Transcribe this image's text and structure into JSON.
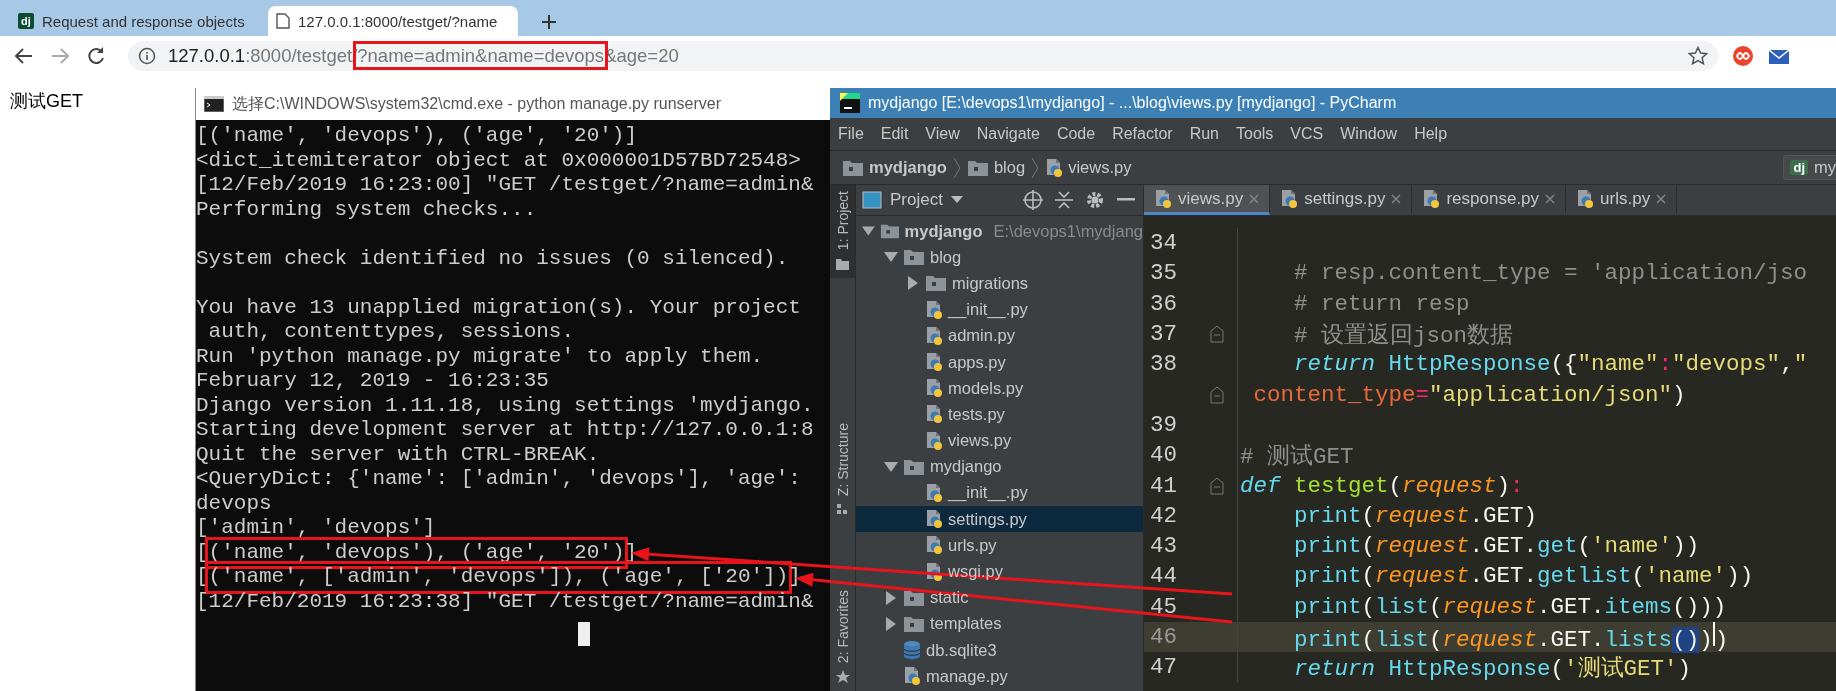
{
  "browser": {
    "tabs": [
      {
        "favicon": "dj",
        "title": "Request and response objects",
        "selected": false
      },
      {
        "title": "127.0.0.1:8000/testget/?name",
        "selected": true
      }
    ],
    "address": {
      "host": "127.0.0.1",
      "path": ":8000/testget/",
      "marked": "?name=admin&name=devops",
      "after": "&age=20"
    }
  },
  "page": {
    "heading": "测试GET"
  },
  "terminal": {
    "title": "选择C:\\WINDOWS\\system32\\cmd.exe - python  manage.py runserver",
    "lines": [
      {
        "kind": "text",
        "text": "[('name', 'devops'), ('age', '20')]"
      },
      {
        "kind": "text",
        "text": "<dict_itemiterator object at 0x000001D57BD72548>"
      },
      {
        "kind": "text",
        "text": "[12/Feb/2019 16:23:00] \"GET /testget/?name=admin&"
      },
      {
        "kind": "text",
        "text": "Performing system checks..."
      },
      {
        "kind": "blank"
      },
      {
        "kind": "text",
        "text": "System check identified no issues (0 silenced)."
      },
      {
        "kind": "blank"
      },
      {
        "kind": "text",
        "text": "You have 13 unapplied migration(s). Your project"
      },
      {
        "kind": "text",
        "text": " auth, contenttypes, sessions."
      },
      {
        "kind": "text",
        "text": "Run 'python manage.py migrate' to apply them."
      },
      {
        "kind": "text",
        "text": "February 12, 2019 - 16:23:35"
      },
      {
        "kind": "text",
        "text": "Django version 1.11.18, using settings 'mydjango."
      },
      {
        "kind": "text",
        "text": "Starting development server at http://127.0.0.1:8"
      },
      {
        "kind": "text",
        "text": "Quit the server with CTRL-BREAK."
      },
      {
        "kind": "text",
        "text": "<QueryDict: {'name': ['admin', 'devops'], 'age':"
      },
      {
        "kind": "text",
        "text": "devops"
      },
      {
        "kind": "text",
        "text": "['admin', 'devops']"
      },
      {
        "kind": "marked",
        "before": "[",
        "text": "('name', 'devops'), ('age', '20')",
        "after": "]"
      },
      {
        "kind": "marked",
        "before": "[",
        "text": "('name', ['admin', 'devops']), ('age', ['20'])",
        "after": "]"
      },
      {
        "kind": "text",
        "text": "[12/Feb/2019 16:23:38] \"GET /testget/?name=admin&"
      }
    ]
  },
  "ide": {
    "title": "mydjango [E:\\devops1\\mydjango] - ...\\blog\\views.py [mydjango] - PyCharm",
    "menu": [
      "File",
      "Edit",
      "View",
      "Navigate",
      "Code",
      "Refactor",
      "Run",
      "Tools",
      "VCS",
      "Window",
      "Help"
    ],
    "breadcrumbs": [
      {
        "kind": "folder",
        "label": "mydjango"
      },
      {
        "kind": "folder",
        "label": "blog"
      },
      {
        "kind": "python",
        "label": "views.py"
      }
    ],
    "run_config": {
      "icon": "dj",
      "label": "my"
    },
    "side_tabs": [
      {
        "label": "1: Project",
        "selected": true
      },
      {
        "label": "Z: Structure",
        "selected": false
      },
      {
        "label": "2: Favorites",
        "selected": false
      }
    ],
    "project_panel": {
      "title": "Project",
      "tree": [
        {
          "kind": "folder",
          "label": "mydjango",
          "path": "E:\\devops1\\mydjang",
          "expanded": true,
          "selected": false,
          "children": [
            {
              "kind": "folder",
              "label": "blog",
              "expanded": true,
              "selected": false,
              "children": [
                {
                  "kind": "folder",
                  "label": "migrations",
                  "expanded": false,
                  "selected": false
                },
                {
                  "kind": "python",
                  "label": "__init__.py",
                  "selected": false
                },
                {
                  "kind": "python",
                  "label": "admin.py",
                  "selected": false
                },
                {
                  "kind": "python",
                  "label": "apps.py",
                  "selected": false
                },
                {
                  "kind": "python",
                  "label": "models.py",
                  "selected": false
                },
                {
                  "kind": "python",
                  "label": "tests.py",
                  "selected": false
                },
                {
                  "kind": "python",
                  "label": "views.py",
                  "selected": false
                }
              ]
            },
            {
              "kind": "folder",
              "label": "mydjango",
              "expanded": true,
              "selected": false,
              "children": [
                {
                  "kind": "python",
                  "label": "__init__.py",
                  "selected": false
                },
                {
                  "kind": "python",
                  "label": "settings.py",
                  "selected": true
                },
                {
                  "kind": "python",
                  "label": "urls.py",
                  "selected": false
                },
                {
                  "kind": "python",
                  "label": "wsgi.py",
                  "selected": false
                }
              ]
            },
            {
              "kind": "folder",
              "label": "static",
              "expanded": false,
              "selected": false
            },
            {
              "kind": "folder",
              "label": "templates",
              "expanded": false,
              "selected": false
            },
            {
              "kind": "database",
              "label": "db.sqlite3",
              "selected": false
            },
            {
              "kind": "python",
              "label": "manage.py",
              "selected": false
            }
          ]
        }
      ]
    },
    "editor_tabs": [
      {
        "label": "views.py",
        "selected": true
      },
      {
        "label": "settings.py",
        "selected": false
      },
      {
        "label": "response.py",
        "selected": false
      },
      {
        "label": "urls.py",
        "selected": false
      }
    ],
    "code": [
      {
        "number": "34",
        "current": false,
        "fold": false
      },
      {
        "number": "35",
        "current": false,
        "fold": false,
        "tokens": [
          {
            "kind": "comment",
            "text": "    # resp.content_type = 'application/jso"
          }
        ]
      },
      {
        "number": "36",
        "current": false,
        "fold": false,
        "tokens": [
          {
            "kind": "comment",
            "text": "    # return resp"
          }
        ]
      },
      {
        "number": "37",
        "current": false,
        "fold": true,
        "tokens": [
          {
            "kind": "comment",
            "text": "    # 设置返回json数据"
          }
        ]
      },
      {
        "number": "38",
        "current": false,
        "fold": false,
        "tokens": [
          {
            "kind": "keyword",
            "text": "    return"
          },
          {
            "kind": "builtin",
            "text": " HttpResponse"
          },
          {
            "kind": "plain",
            "text": "({"
          },
          {
            "kind": "string",
            "text": "\"name\""
          },
          {
            "kind": "operator",
            "text": ":"
          },
          {
            "kind": "string",
            "text": "\"devops\""
          },
          {
            "kind": "plain",
            "text": ","
          },
          {
            "kind": "string",
            "text": "\""
          }
        ]
      },
      {
        "current": false,
        "fold": true,
        "tokens": [
          {
            "kind": "kwarg",
            "text": " content_type"
          },
          {
            "kind": "operator",
            "text": "="
          },
          {
            "kind": "string",
            "text": "\"application/json\""
          },
          {
            "kind": "plain",
            "text": ")"
          }
        ]
      },
      {
        "number": "39",
        "current": false,
        "fold": false
      },
      {
        "number": "40",
        "current": false,
        "fold": false,
        "tokens": [
          {
            "kind": "comment",
            "text": "# 测试GET"
          }
        ]
      },
      {
        "number": "41",
        "current": false,
        "fold": true,
        "tokens": [
          {
            "kind": "keyword",
            "text": "def"
          },
          {
            "kind": "function",
            "text": " testget"
          },
          {
            "kind": "plain",
            "text": "("
          },
          {
            "kind": "param",
            "text": "request"
          },
          {
            "kind": "plain",
            "text": ")"
          },
          {
            "kind": "operator",
            "text": ":"
          }
        ]
      },
      {
        "number": "42",
        "current": false,
        "fold": false,
        "tokens": [
          {
            "kind": "builtin",
            "text": "    print"
          },
          {
            "kind": "plain",
            "text": "("
          },
          {
            "kind": "param",
            "text": "request"
          },
          {
            "kind": "plain",
            "text": ".GET)"
          }
        ]
      },
      {
        "number": "43",
        "current": false,
        "fold": false,
        "tokens": [
          {
            "kind": "builtin",
            "text": "    print"
          },
          {
            "kind": "plain",
            "text": "("
          },
          {
            "kind": "param",
            "text": "request"
          },
          {
            "kind": "plain",
            "text": ".GET."
          },
          {
            "kind": "builtin",
            "text": "get"
          },
          {
            "kind": "plain",
            "text": "("
          },
          {
            "kind": "string",
            "text": "'name'"
          },
          {
            "kind": "plain",
            "text": "))"
          }
        ]
      },
      {
        "number": "44",
        "current": false,
        "fold": false,
        "tokens": [
          {
            "kind": "builtin",
            "text": "    print"
          },
          {
            "kind": "plain",
            "text": "("
          },
          {
            "kind": "param",
            "text": "request"
          },
          {
            "kind": "plain",
            "text": ".GET."
          },
          {
            "kind": "builtin",
            "text": "getlist"
          },
          {
            "kind": "plain",
            "text": "("
          },
          {
            "kind": "string",
            "text": "'name'"
          },
          {
            "kind": "plain",
            "text": "))"
          }
        ]
      },
      {
        "number": "45",
        "current": false,
        "fold": false,
        "tokens": [
          {
            "kind": "builtin",
            "text": "    print"
          },
          {
            "kind": "plain",
            "text": "("
          },
          {
            "kind": "builtin",
            "text": "list"
          },
          {
            "kind": "plain",
            "text": "("
          },
          {
            "kind": "param",
            "text": "request"
          },
          {
            "kind": "plain",
            "text": ".GET."
          },
          {
            "kind": "builtin",
            "text": "items"
          },
          {
            "kind": "plain",
            "text": "()))"
          }
        ]
      },
      {
        "number": "46",
        "current": true,
        "fold": false,
        "tokens": [
          {
            "kind": "builtin",
            "text": "    print"
          },
          {
            "kind": "plain",
            "text": "("
          },
          {
            "kind": "builtin",
            "text": "list"
          },
          {
            "kind": "plain",
            "text": "("
          },
          {
            "kind": "param",
            "text": "request"
          },
          {
            "kind": "plain",
            "text": ".GET."
          },
          {
            "kind": "builtin",
            "text": "lists"
          },
          {
            "kind": "selected",
            "text": "()"
          },
          {
            "kind": "plain",
            "text": ")"
          },
          {
            "kind": "caret"
          },
          {
            "kind": "plain",
            "text": ")"
          }
        ]
      },
      {
        "number": "47",
        "current": false,
        "fold": false,
        "tokens": [
          {
            "kind": "keyword",
            "text": "    return"
          },
          {
            "kind": "builtin",
            "text": " HttpResponse"
          },
          {
            "kind": "plain",
            "text": "("
          },
          {
            "kind": "string",
            "text": "'测试GET'"
          },
          {
            "kind": "plain",
            "text": ")"
          }
        ]
      }
    ]
  }
}
